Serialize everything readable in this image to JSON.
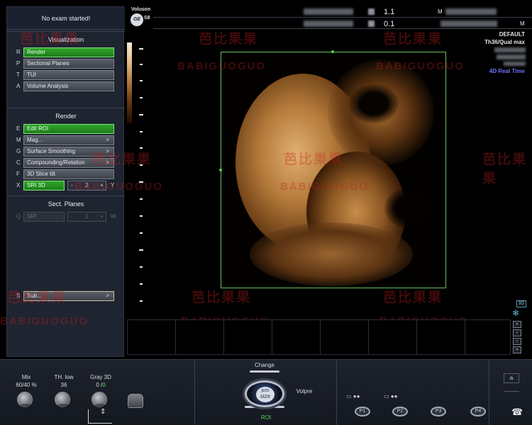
{
  "status": "No exam started!",
  "sections": {
    "visualization": {
      "title": "Visualization",
      "items": [
        {
          "key": "R",
          "label": "Render",
          "style": "green",
          "arrow": ""
        },
        {
          "key": "P",
          "label": "Sectional Planes",
          "style": "gray",
          "arrow": ""
        },
        {
          "key": "T",
          "label": "TUI",
          "style": "gray",
          "arrow": ""
        },
        {
          "key": "A",
          "label": "Volume Analysis",
          "style": "gray",
          "arrow": ""
        }
      ]
    },
    "render": {
      "title": "Render",
      "items": [
        {
          "key": "E",
          "label": "Edit ROI",
          "style": "green",
          "arrow": ""
        },
        {
          "key": "M",
          "label": "Mag...",
          "style": "gray",
          "arrow": ">"
        },
        {
          "key": "G",
          "label": "Surface Smoothing",
          "style": "gray",
          "arrow": ">"
        },
        {
          "key": "C",
          "label": "Compounding/Relation",
          "style": "gray",
          "arrow": ">"
        },
        {
          "key": "F",
          "label": "3D Slice tilt",
          "style": "gray",
          "arrow": ""
        },
        {
          "key": "X",
          "label": "SRI 3D",
          "style": "green",
          "arrow": ""
        }
      ],
      "spinner": {
        "minus": "-",
        "value": "2",
        "plus": "+",
        "suffix": "Y"
      }
    },
    "sect_planes": {
      "title": "Sect. Planes",
      "item": {
        "key": "Q",
        "label": "SRI",
        "style": "disabled"
      },
      "spinner": {
        "minus": "-",
        "value": "1",
        "plus": "+",
        "suffix": "W"
      }
    },
    "sub": {
      "key": "S",
      "label": "Sub...",
      "arrow": ">"
    }
  },
  "header": {
    "brand": "Voluson",
    "model": "S8",
    "logo": "GE",
    "val1": "1.1",
    "val2": "0.1",
    "m1": "M",
    "m2": "M"
  },
  "right_info": {
    "preset": "DEFAULT",
    "quality": "Th36/Qual max",
    "mode": "4D Real Time"
  },
  "watermark": {
    "cn": "芭比果果",
    "en": "BABIGUOGUO"
  },
  "side_controls": {
    "badge_3d": "3D",
    "freeze_icon": "❄",
    "nav": [
      "«",
      "‹",
      "›",
      "»"
    ]
  },
  "bottom": {
    "knobs": [
      {
        "name": "Mix",
        "value": "60/40 %"
      },
      {
        "name": "TH. low",
        "value": "36"
      },
      {
        "name": "Gray 3D",
        "value": "0 /",
        "value2": "0"
      }
    ],
    "trackball": {
      "top": "Change",
      "inner_top": "pos",
      "inner_bottom": "size",
      "right": "Volpre",
      "bottom": "ROI"
    },
    "p_buttons": [
      "P1",
      "P2",
      "P3",
      "P4"
    ],
    "right_label": "a"
  },
  "colors": {
    "panel": "#1f2431",
    "green_button": "#2fa52a",
    "roi_border": "#6cbf58",
    "mode_text": "#6f71ff"
  }
}
